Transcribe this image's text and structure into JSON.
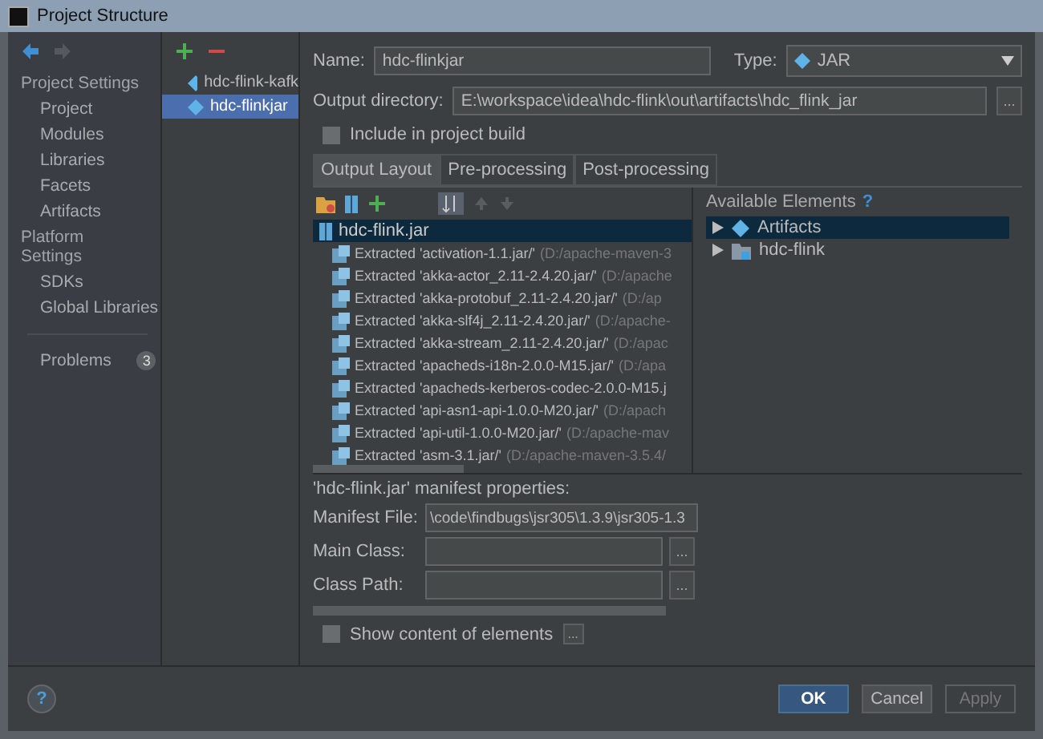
{
  "window": {
    "title": "Project Structure"
  },
  "sidebar": {
    "items": [
      {
        "kind": "header",
        "label": "Project Settings"
      },
      {
        "kind": "item",
        "label": "Project"
      },
      {
        "kind": "item",
        "label": "Modules"
      },
      {
        "kind": "item",
        "label": "Libraries"
      },
      {
        "kind": "item",
        "label": "Facets"
      },
      {
        "kind": "item",
        "label": "Artifacts"
      },
      {
        "kind": "header",
        "label": "Platform Settings"
      },
      {
        "kind": "item",
        "label": "SDKs"
      },
      {
        "kind": "item",
        "label": "Global Libraries"
      },
      {
        "kind": "problems",
        "label": "Problems",
        "badge": "3"
      }
    ]
  },
  "artifacts": [
    {
      "label": "hdc-flink-kafk",
      "selected": false
    },
    {
      "label": "hdc-flinkjar",
      "selected": true
    }
  ],
  "name_field": {
    "label": "Name:",
    "value": "hdc-flinkjar"
  },
  "type_field": {
    "label": "Type:",
    "value": "JAR"
  },
  "output_directory": {
    "label": "Output directory:",
    "value": "E:\\workspace\\idea\\hdc-flink\\out\\artifacts\\hdc_flink_jar",
    "button": "..."
  },
  "include_in_build": {
    "label": "Include in project build",
    "checked": false
  },
  "tabs": [
    {
      "label": "Output Layout",
      "selected": true
    },
    {
      "label": "Pre-processing",
      "selected": false
    },
    {
      "label": "Post-processing",
      "selected": false
    }
  ],
  "layout_tree": {
    "root": {
      "label": "hdc-flink.jar",
      "selected": true
    },
    "children": [
      {
        "name": "Extracted 'activation-1.1.jar/'",
        "path": "(D:/apache-maven-3"
      },
      {
        "name": "Extracted 'akka-actor_2.11-2.4.20.jar/'",
        "path": "(D:/apache"
      },
      {
        "name": "Extracted 'akka-protobuf_2.11-2.4.20.jar/'",
        "path": "(D:/ap"
      },
      {
        "name": "Extracted 'akka-slf4j_2.11-2.4.20.jar/'",
        "path": "(D:/apache-"
      },
      {
        "name": "Extracted 'akka-stream_2.11-2.4.20.jar/'",
        "path": "(D:/apac"
      },
      {
        "name": "Extracted 'apacheds-i18n-2.0.0-M15.jar/'",
        "path": "(D:/apa"
      },
      {
        "name": "Extracted 'apacheds-kerberos-codec-2.0.0-M15.j"
      },
      {
        "name": "Extracted 'api-asn1-api-1.0.0-M20.jar/'",
        "path": "(D:/apach"
      },
      {
        "name": "Extracted 'api-util-1.0.0-M20.jar/'",
        "path": "(D:/apache-mav"
      },
      {
        "name": "Extracted 'asm-3.1.jar/'",
        "path": "(D:/apache-maven-3.5.4/"
      }
    ]
  },
  "available_elements": {
    "title": "Available Elements",
    "help": "?",
    "items": [
      {
        "label": "Artifacts",
        "kind": "artifact",
        "selected": true
      },
      {
        "label": "hdc-flink",
        "kind": "module",
        "selected": false
      }
    ]
  },
  "manifest": {
    "title": "'hdc-flink.jar' manifest properties:",
    "fields": [
      {
        "label": "Manifest File:",
        "value": "\\code\\findbugs\\jsr305\\1.3.9\\jsr305-1.3",
        "button": false
      },
      {
        "label": "Main Class:",
        "button": true
      },
      {
        "label": "Class Path:",
        "button": true
      }
    ],
    "button_text": "..."
  },
  "show_content": {
    "label": "Show content of elements",
    "checked": false,
    "button": "..."
  },
  "help_button": "?",
  "buttons": [
    {
      "label": "OK",
      "kind": "default",
      "disabled": false
    },
    {
      "label": "Cancel",
      "kind": "normal",
      "disabled": false
    },
    {
      "label": "Apply",
      "kind": "normal",
      "disabled": true
    }
  ]
}
